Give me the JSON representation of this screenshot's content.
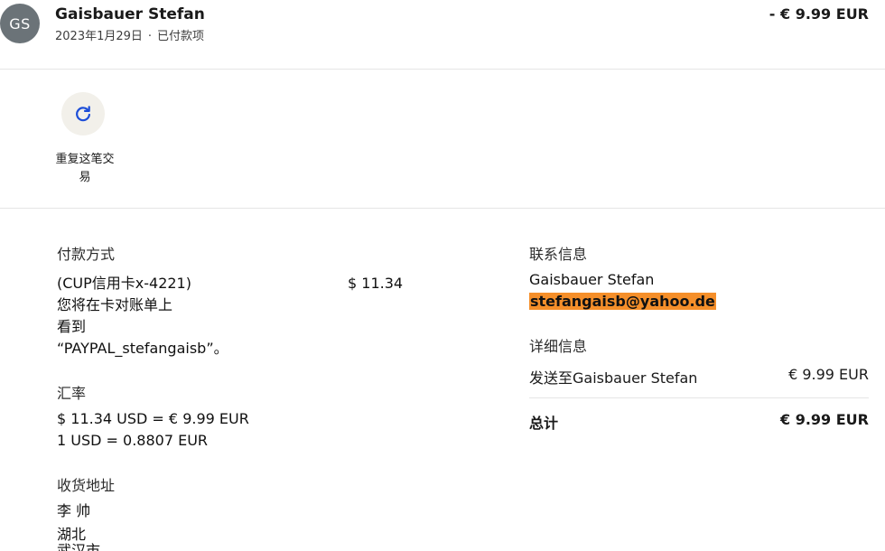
{
  "header": {
    "avatar_initials": "GS",
    "name": "Gaisbauer Stefan",
    "date": "2023年1月29日",
    "separator": "·",
    "status": "已付款项",
    "amount": "- € 9.99 EUR"
  },
  "actions": {
    "repeat_label": "重复这笔交易",
    "repeat_icon": "refresh-icon"
  },
  "payment_method": {
    "title": "付款方式",
    "lines": [
      "(CUP信用卡x-4221)",
      "您将在卡对账单上",
      "看到",
      "“PAYPAL_stefangaisb”。"
    ],
    "amount": "$ 11.34"
  },
  "exchange_rate": {
    "title": "汇率",
    "line1": "$ 11.34 USD = € 9.99 EUR",
    "line2": "1 USD = 0.8807 EUR"
  },
  "shipping_address": {
    "title": "收货地址",
    "lines": [
      "李 帅",
      "湖北",
      "武汉市"
    ]
  },
  "contact_info": {
    "title": "联系信息",
    "name": "Gaisbauer Stefan",
    "email": "stefangaisb@yahoo.de"
  },
  "details": {
    "title": "详细信息",
    "item_label": "发送至Gaisbauer Stefan",
    "item_amount": "€ 9.99 EUR",
    "total_label": "总计",
    "total_amount": "€ 9.99 EUR"
  },
  "colors": {
    "avatar_bg": "#6b7378",
    "email_highlight": "#f58f2a",
    "repeat_btn_bg": "#f2f0ea",
    "icon_blue": "#1d4ed8"
  }
}
